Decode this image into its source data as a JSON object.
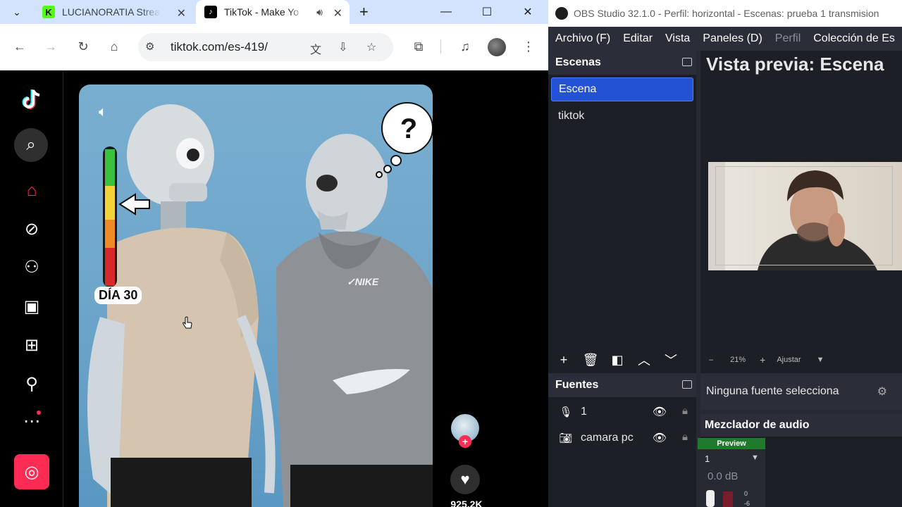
{
  "browser": {
    "tabs": [
      {
        "title": "LUCIANORATIA Strea",
        "favicon": "kick-icon",
        "favicon_color": "#53fc18"
      },
      {
        "title": "TikTok - Make Yo",
        "favicon": "tiktok-icon",
        "active": true,
        "playing_audio": true
      }
    ],
    "url": "tiktok.com/es-419/"
  },
  "tiktok": {
    "video_label": "DÍA 30",
    "like_count": "925.2K"
  },
  "obs": {
    "window_title": "OBS Studio 32.1.0 - Perfil: horizontal - Escenas: prueba 1 transmision",
    "menu": [
      {
        "label": "Archivo (F)",
        "enabled": true
      },
      {
        "label": "Editar",
        "enabled": true
      },
      {
        "label": "Vista",
        "enabled": true
      },
      {
        "label": "Paneles (D)",
        "enabled": true
      },
      {
        "label": "Perfil",
        "enabled": false
      },
      {
        "label": "Colección de Es",
        "enabled": true
      }
    ],
    "scenes_title": "Escenas",
    "scenes": [
      {
        "name": "Escena",
        "selected": true
      },
      {
        "name": "tiktok",
        "selected": false
      }
    ],
    "preview_title": "Vista previa: Escena",
    "zoom": {
      "minus": "–",
      "level": "21%",
      "plus": "+",
      "fit_label": "Ajustar"
    },
    "sources_title": "Fuentes",
    "sources": [
      {
        "name": "1",
        "icon": "microphone-icon"
      },
      {
        "name": "camara pc",
        "icon": "camera-icon"
      }
    ],
    "no_source_text": "Ninguna fuente selecciona",
    "mixer": {
      "title": "Mezclador de audio",
      "tag": "Preview",
      "channel_name": "1",
      "db": "0.0 dB",
      "ticks": [
        "0",
        "-6"
      ]
    }
  }
}
